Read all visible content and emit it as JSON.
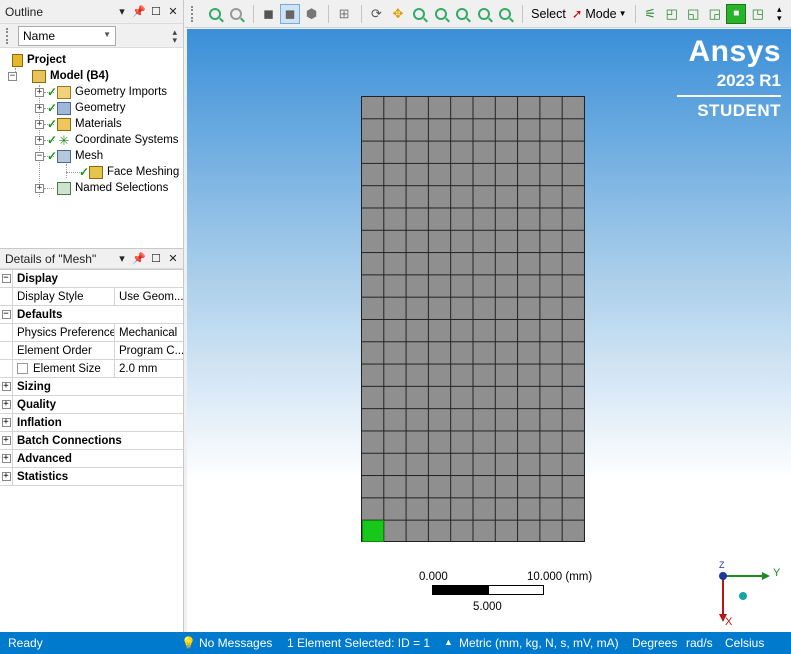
{
  "outline": {
    "title": "Outline",
    "filter_value": "Name",
    "tree": {
      "project": "Project",
      "model": "Model (B4)",
      "geometry_imports": "Geometry Imports",
      "geometry": "Geometry",
      "materials": "Materials",
      "coordinate_systems": "Coordinate Systems",
      "mesh": "Mesh",
      "face_meshing": "Face Meshing",
      "named_selections": "Named Selections"
    }
  },
  "details": {
    "title": "Details of \"Mesh\"",
    "groups": {
      "display": "Display",
      "defaults": "Defaults",
      "sizing": "Sizing",
      "quality": "Quality",
      "inflation": "Inflation",
      "batch_connections": "Batch Connections",
      "advanced": "Advanced",
      "statistics": "Statistics"
    },
    "props": {
      "display_style_key": "Display Style",
      "display_style_val": "Use Geom...",
      "physics_pref_key": "Physics Preference",
      "physics_pref_val": "Mechanical",
      "element_order_key": "Element Order",
      "element_order_val": "Program C...",
      "element_size_key": "Element Size",
      "element_size_val": "2.0 mm"
    }
  },
  "toolbar": {
    "select_label": "Select",
    "mode_label": "Mode"
  },
  "viewport": {
    "brand": "Ansys",
    "version": "2023 R1",
    "edition": "STUDENT",
    "scale_start": "0.000",
    "scale_end": "10.000 (mm)",
    "scale_mid": "5.000",
    "axis_y": "Y",
    "axis_x": "X",
    "axis_z": "Z"
  },
  "status": {
    "ready": "Ready",
    "messages": "No Messages",
    "selection": "1 Element Selected: ID = 1",
    "units": "Metric (mm, kg, N, s, mV, mA)",
    "angle": "Degrees",
    "rate": "rad/s",
    "temp": "Celsius"
  },
  "colors": {
    "status_bar": "#007acc",
    "mesh_fill": "#8f8f8f",
    "selected_element": "#17c71a"
  }
}
